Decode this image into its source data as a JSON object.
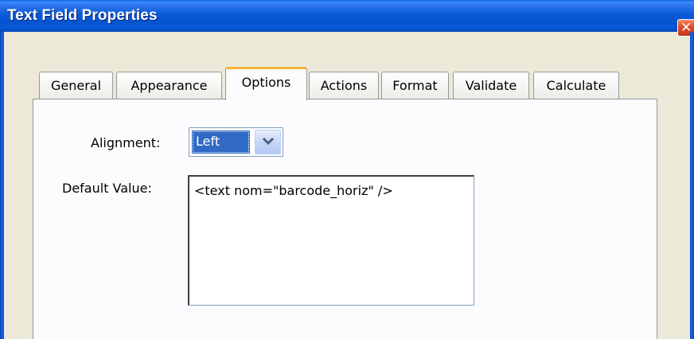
{
  "window": {
    "title": "Text Field Properties",
    "close_glyph": "✕"
  },
  "tabs": [
    {
      "label": "General",
      "active": false
    },
    {
      "label": "Appearance",
      "active": false
    },
    {
      "label": "Options",
      "active": true
    },
    {
      "label": "Actions",
      "active": false
    },
    {
      "label": "Format",
      "active": false
    },
    {
      "label": "Validate",
      "active": false
    },
    {
      "label": "Calculate",
      "active": false
    }
  ],
  "options": {
    "alignment_label": "Alignment:",
    "alignment_value": "Left",
    "default_value_label": "Default Value:",
    "default_value": "<text nom=\"barcode_horiz\" />"
  },
  "colors": {
    "titlebar": "#0554d0",
    "selection": "#316ac5",
    "active_tab_accent": "#f3b33d",
    "close_button": "#e0502a"
  },
  "icons": {
    "close": "close-icon",
    "dropdown": "chevron-down-icon"
  }
}
